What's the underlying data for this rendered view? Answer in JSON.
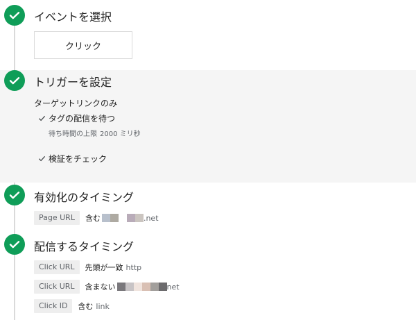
{
  "sections": {
    "event": {
      "title": "イベントを選択",
      "value": "クリック"
    },
    "trigger": {
      "title": "トリガーを設定",
      "type": "ターゲットリンクのみ",
      "wait_option": "タグの配信を待つ",
      "wait_limit_label": "待ち時間の上限",
      "wait_limit_value": "2000 ミリ秒",
      "validate_option": "検証をチェック"
    },
    "enable": {
      "title": "有効化のタイミング",
      "conditions": [
        {
          "variable": "Page URL",
          "operator": "含む",
          "value_suffix": ".net",
          "redacted_colors": [
            "#b8c0cc",
            "#aeaaa2",
            "#ffffff",
            "#b9acb9",
            "#cbc5c0"
          ]
        }
      ]
    },
    "fire": {
      "title": "配信するタイミング",
      "conditions": [
        {
          "variable": "Click URL",
          "operator": "先頭が一致",
          "value": "http"
        },
        {
          "variable": "Click URL",
          "operator": "含まない",
          "value_suffix": "net",
          "redacted_colors": [
            "#7a787c",
            "#c8c4c6",
            "#f0e4de",
            "#d9c0b4",
            "#a29f9c",
            "#6c6b6d"
          ]
        },
        {
          "variable": "Click ID",
          "operator": "含む",
          "value": "link"
        }
      ]
    }
  },
  "colors": {
    "check_green": "#0f9d58",
    "chip_bg": "#eeeeee",
    "band_bg": "#f5f5f5",
    "timeline": "#dadada"
  }
}
